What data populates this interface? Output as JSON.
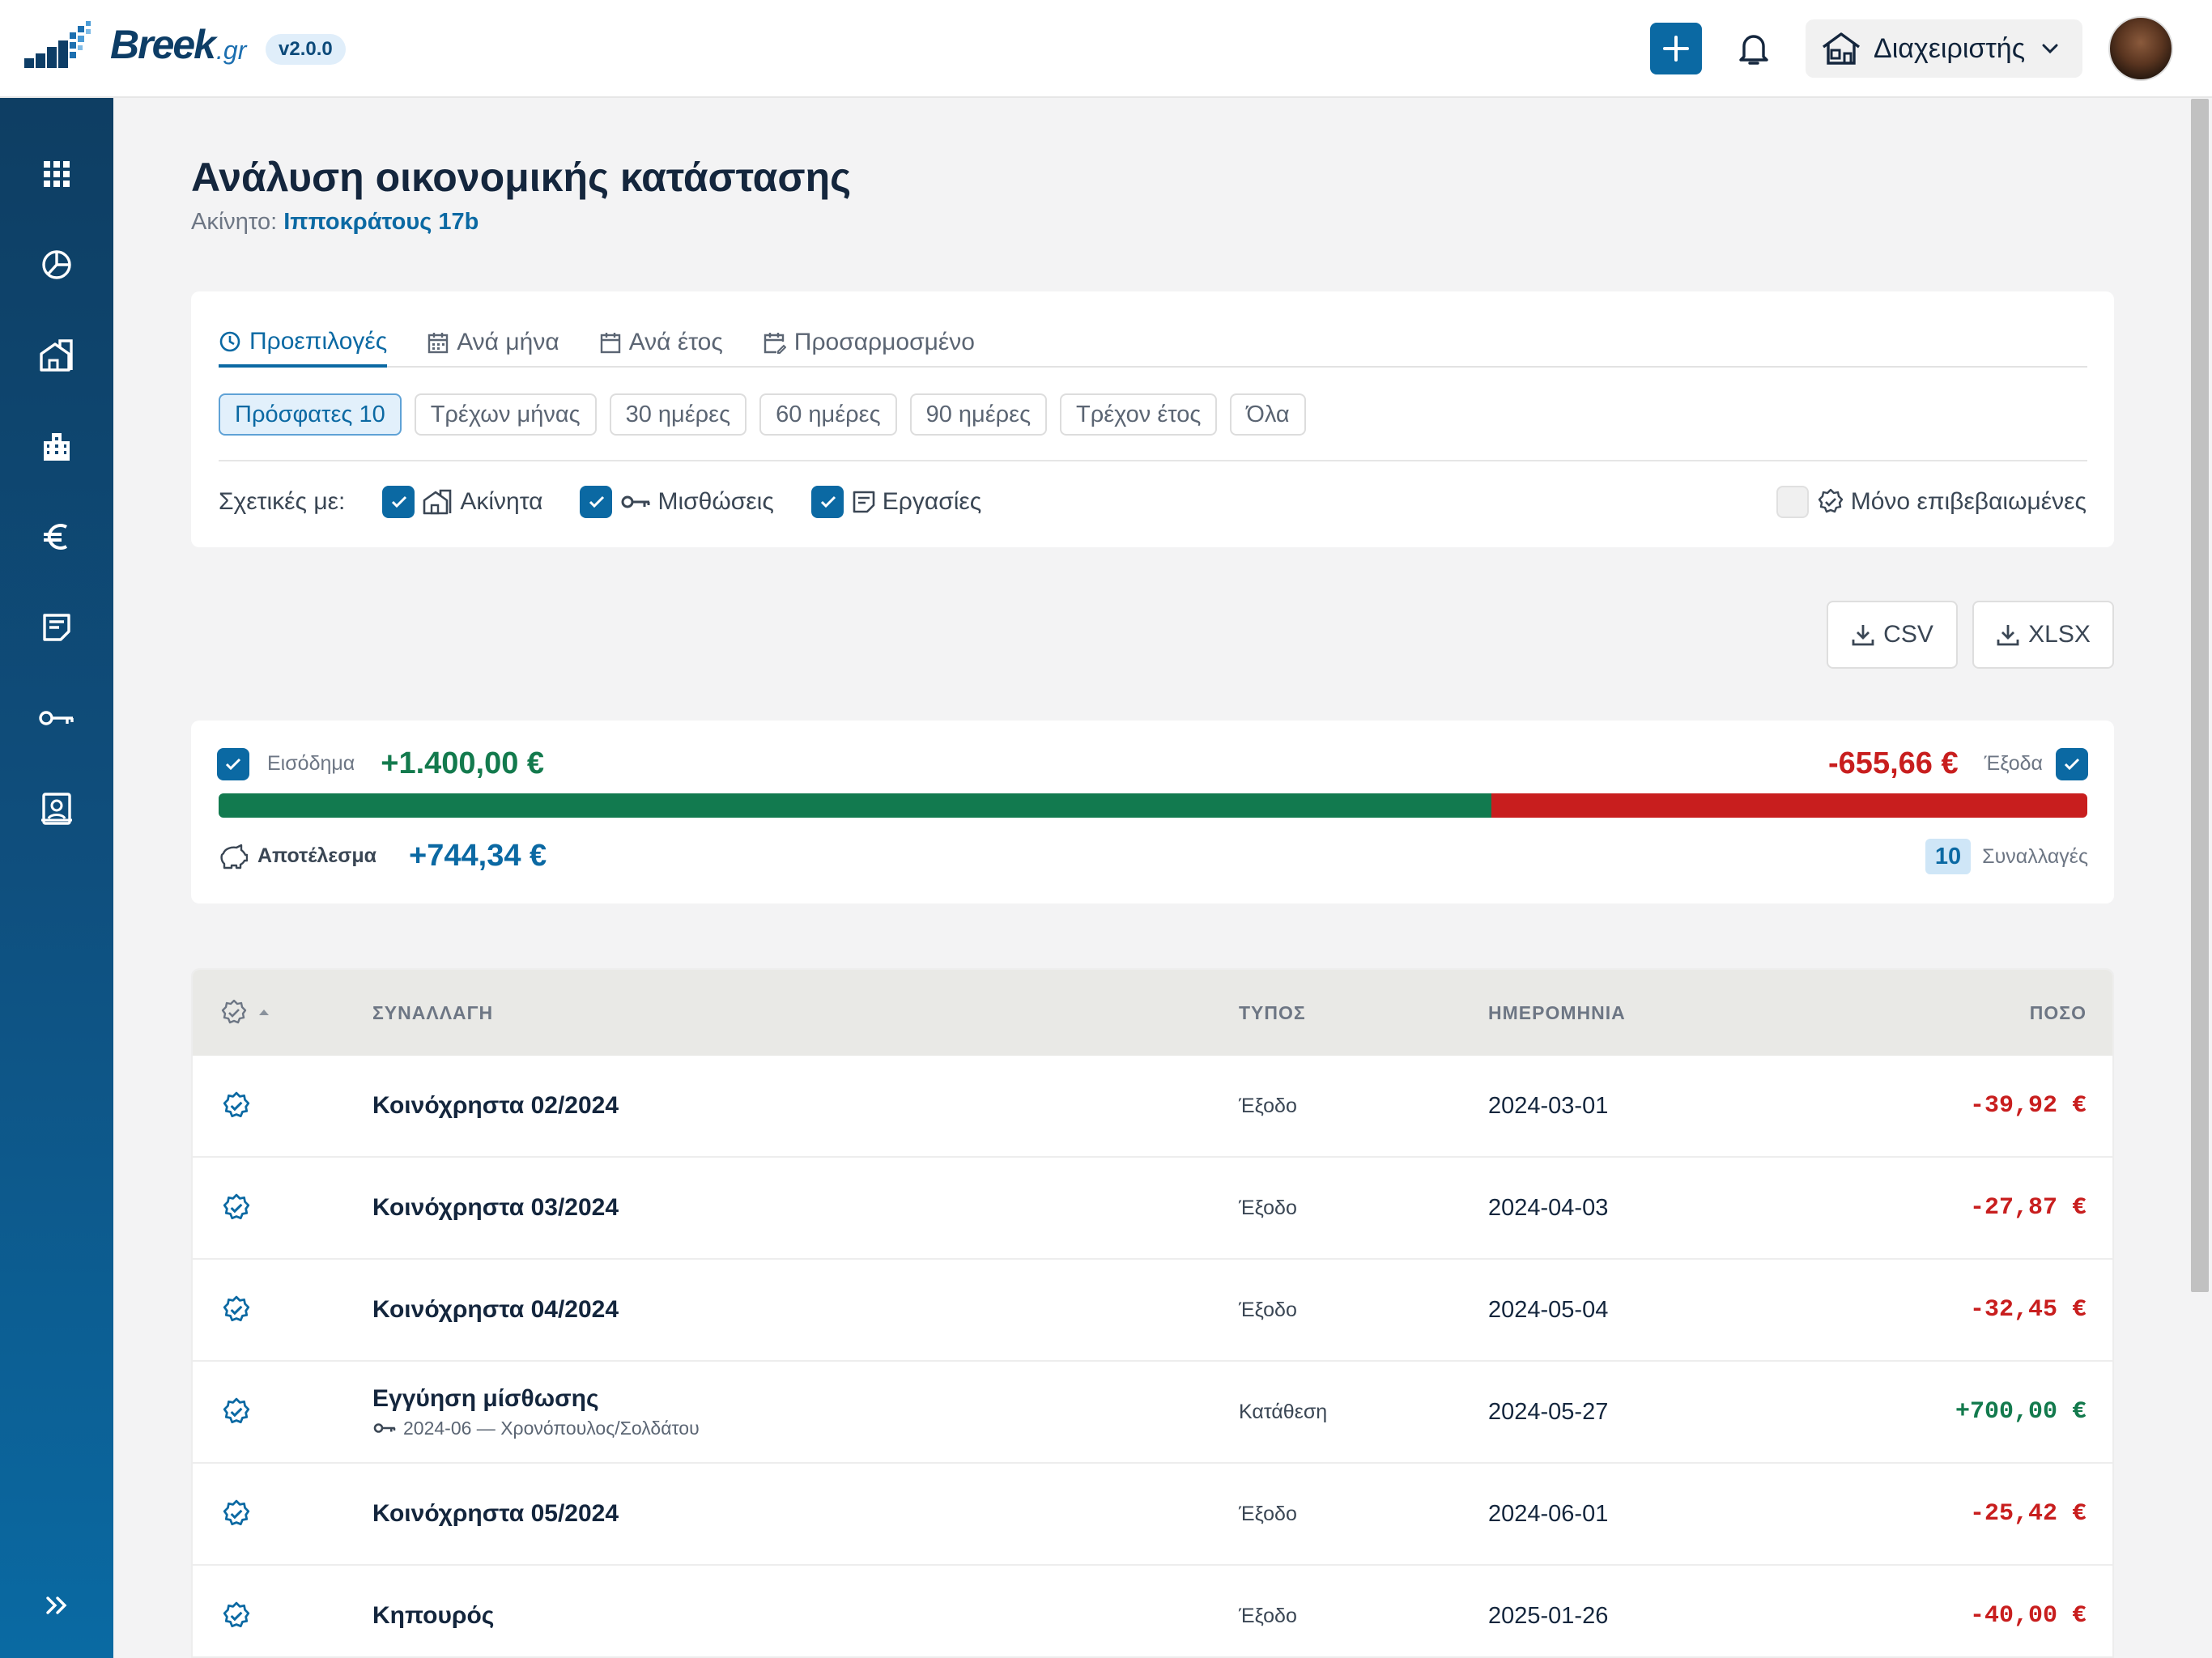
{
  "app": {
    "brand": "Breek",
    "brand_suffix": ".gr",
    "version": "v2.0.0"
  },
  "header": {
    "role_label": "Διαχειριστής"
  },
  "sidebar": {
    "items": [
      "dashboard-icon",
      "analytics-icon",
      "properties-icon",
      "buildings-icon",
      "euro-icon",
      "tasks-icon",
      "leases-icon",
      "contacts-icon"
    ],
    "expand_icon": "double-chevron-right-icon"
  },
  "page": {
    "title": "Ανάλυση οικονομικής κατάστασης",
    "property_label": "Ακίνητο:",
    "property_name": "Ιπποκράτους 17b"
  },
  "filters": {
    "tabs": [
      {
        "label": "Προεπιλογές",
        "icon": "clock-icon",
        "active": true
      },
      {
        "label": "Ανά μήνα",
        "icon": "calendar-icon",
        "active": false
      },
      {
        "label": "Ανά έτος",
        "icon": "calendar-icon",
        "active": false
      },
      {
        "label": "Προσαρμοσμένο",
        "icon": "calendar-edit-icon",
        "active": false
      }
    ],
    "chips": [
      "Πρόσφατες 10",
      "Τρέχων μήνας",
      "30 ημέρες",
      "60 ημέρες",
      "90 ημέρες",
      "Τρέχον έτος",
      "Όλα"
    ],
    "active_chip": "Πρόσφατες 10",
    "related_label": "Σχετικές με:",
    "related": [
      {
        "label": "Ακίνητα",
        "checked": true
      },
      {
        "label": "Μισθώσεις",
        "checked": true
      },
      {
        "label": "Εργασίες",
        "checked": true
      }
    ],
    "only_confirmed_label": "Μόνο επιβεβαιωμένες",
    "only_confirmed": false
  },
  "export": {
    "csv": "CSV",
    "xlsx": "XLSX"
  },
  "summary": {
    "income_label": "Εισόδημα",
    "income_value": "+1.400,00 €",
    "income_checked": true,
    "expense_label": "Έξοδα",
    "expense_value": "-655,66 €",
    "expense_checked": true,
    "income_share": 0.681,
    "result_label": "Αποτέλεσμα",
    "result_value": "+744,34 €",
    "tx_count": "10",
    "tx_label": "Συναλλαγές",
    "colors": {
      "income": "#127a4f",
      "expense": "#c81e1e",
      "accent": "#0b69a3"
    }
  },
  "table": {
    "headers": {
      "transaction": "ΣΥΝΑΛΛΑΓΗ",
      "type": "ΤΥΠΟΣ",
      "date": "ΗΜΕΡΟΜΗΝΙΑ",
      "amount": "ΠΟΣΟ"
    },
    "rows": [
      {
        "title": "Κοινόχρηστα 02/2024",
        "subtitle": "",
        "type": "Έξοδο",
        "date": "2024-03-01",
        "amount": "-39,92 €",
        "sign": "neg"
      },
      {
        "title": "Κοινόχρηστα 03/2024",
        "subtitle": "",
        "type": "Έξοδο",
        "date": "2024-04-03",
        "amount": "-27,87 €",
        "sign": "neg"
      },
      {
        "title": "Κοινόχρηστα 04/2024",
        "subtitle": "",
        "type": "Έξοδο",
        "date": "2024-05-04",
        "amount": "-32,45 €",
        "sign": "neg"
      },
      {
        "title": "Εγγύηση μίσθωσης",
        "subtitle": "2024-06 — Χρονόπουλος/Σολδάτου",
        "type": "Κατάθεση",
        "date": "2024-05-27",
        "amount": "+700,00 €",
        "sign": "pos"
      },
      {
        "title": "Κοινόχρηστα 05/2024",
        "subtitle": "",
        "type": "Έξοδο",
        "date": "2024-06-01",
        "amount": "-25,42 €",
        "sign": "neg"
      },
      {
        "title": "Κηπουρός",
        "subtitle": "",
        "type": "Έξοδο",
        "date": "2025-01-26",
        "amount": "-40,00 €",
        "sign": "neg"
      }
    ]
  }
}
